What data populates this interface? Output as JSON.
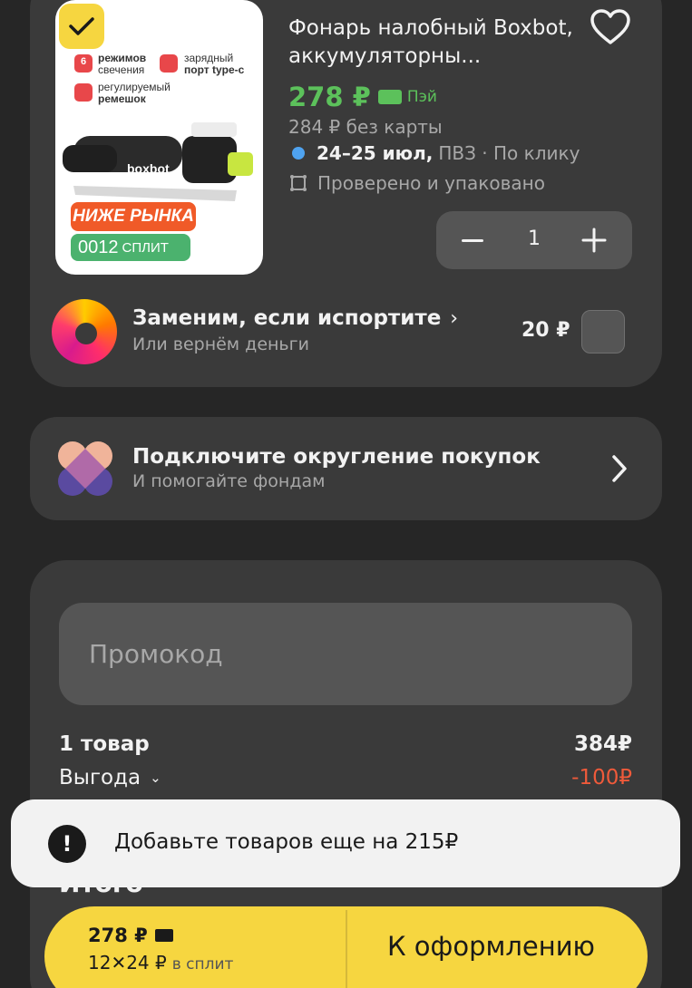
{
  "product": {
    "title": "Фонарь налобный Boxbot, аккумуляторны...",
    "price": "278 ₽",
    "pay_label": "Пэй",
    "price_without_card": "284 ₽ без карты",
    "delivery_date": "24–25 июл,",
    "delivery_rest": "ПВЗ · По клику",
    "checked_label": "Проверено и упаковано",
    "quantity": "1",
    "selected": true,
    "image": {
      "feature1_bold": "режимов",
      "feature1_rest": "свечения",
      "feature1_num": "6",
      "feature2_line1": "зарядный",
      "feature2_line2": "порт type-c",
      "feature3_line1": "регулируемый",
      "feature3_line2": "ремешок",
      "brand": "boxbot",
      "badge_red": "НИЖЕ РЫНКА",
      "badge_green_num": "0012",
      "badge_green_word": "СПЛИТ"
    }
  },
  "replacement": {
    "title": "Заменим, если испортите",
    "subtitle": "Или вернём деньги",
    "price": "20 ₽"
  },
  "rounding": {
    "title": "Подключите округление покупок",
    "subtitle": "И помогайте фондам"
  },
  "summary": {
    "promo_placeholder": "Промокод",
    "items_label": "1 товар",
    "items_price": "384₽",
    "discount_label": "Выгода",
    "discount_value": "-100₽",
    "total_label": "Итого"
  },
  "toast": {
    "icon": "!",
    "text": "Добавьте товаров еще на 215₽"
  },
  "checkout": {
    "price": "278 ₽",
    "split": "12✕24 ₽",
    "split_suffix": "в сплит",
    "button_label": "К оформлению"
  },
  "colors": {
    "accent_green": "#5cc15b",
    "accent_yellow": "#f6d640",
    "discount_red": "#ef5a3a"
  }
}
